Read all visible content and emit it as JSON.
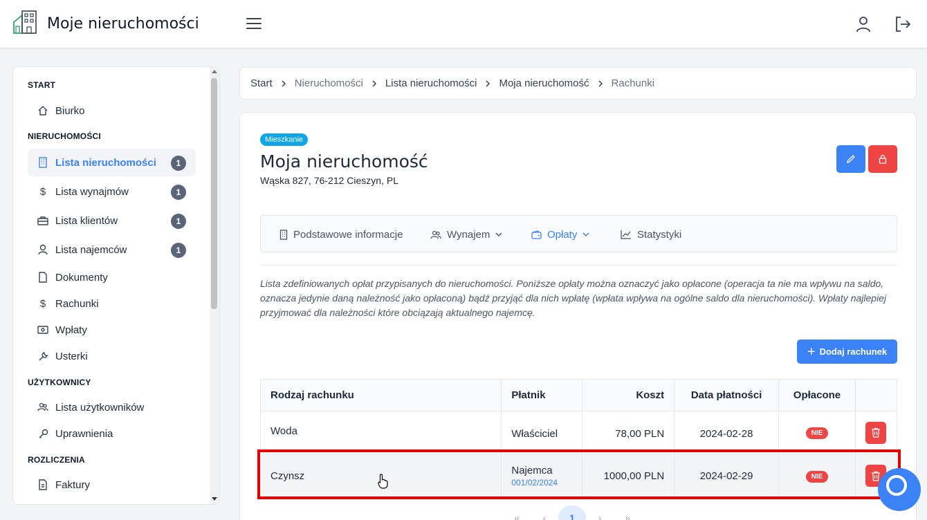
{
  "header": {
    "title": "Moje nieruchomości"
  },
  "sidebar": {
    "sections": {
      "start": "START",
      "nieruchomosci": "NIERUCHOMOŚCI",
      "uzytkownicy": "UŻYTKOWNICY",
      "rozliczenia": "ROZLICZENIA"
    },
    "items": [
      {
        "label": "Biurko",
        "icon": "home-icon"
      },
      {
        "label": "Lista nieruchomości",
        "icon": "building-icon",
        "badge": "1",
        "active": true
      },
      {
        "label": "Lista wynajmów",
        "icon": "dollar-icon",
        "badge": "1"
      },
      {
        "label": "Lista klientów",
        "icon": "briefcase-icon",
        "badge": "1"
      },
      {
        "label": "Lista najemców",
        "icon": "user-icon",
        "badge": "1"
      },
      {
        "label": "Dokumenty",
        "icon": "file-icon"
      },
      {
        "label": "Rachunki",
        "icon": "dollar-icon"
      },
      {
        "label": "Wpłaty",
        "icon": "cash-icon"
      },
      {
        "label": "Usterki",
        "icon": "wrench-icon"
      },
      {
        "label": "Lista użytkowników",
        "icon": "users-icon"
      },
      {
        "label": "Uprawnienia",
        "icon": "key-icon"
      },
      {
        "label": "Faktury",
        "icon": "invoice-icon"
      }
    ]
  },
  "breadcrumb": [
    "Start",
    "Nieruchomości",
    "Lista nieruchomości",
    "Moja nieruchomość",
    "Rachunki"
  ],
  "property": {
    "type_badge": "Mieszkanie",
    "name": "Moja nieruchomość",
    "address": "Wąska 827, 76-212 Cieszyn, PL"
  },
  "tabs": [
    {
      "label": "Podstawowe informacje",
      "icon": "building-icon"
    },
    {
      "label": "Wynajem",
      "icon": "users-icon",
      "dropdown": true
    },
    {
      "label": "Opłaty",
      "icon": "wallet-icon",
      "dropdown": true,
      "active": true
    },
    {
      "label": "Statystyki",
      "icon": "chart-icon"
    }
  ],
  "description": "Lista zdefiniowanych opłat przypisanych do nieruchomości. Poniższe opłaty można oznaczyć jako opłacone (operacja ta nie ma wpływu na saldo, oznacza jedynie daną należność jako opłaconą) bądź przyjąć dla nich wpłatę (wpłata wpływa na ogólne saldo dla nieruchomości). Wpłaty najlepiej przyjmować dla należności które obciązają aktualnego najemcę.",
  "add_button": "Dodaj rachunek",
  "table": {
    "headers": [
      "Rodzaj rachunku",
      "Płatnik",
      "Koszt",
      "Data płatności",
      "Opłacone"
    ],
    "rows": [
      {
        "type": "Woda",
        "payer": "Właściciel",
        "payer_sub": "",
        "cost": "78,00 PLN",
        "date": "2024-02-28",
        "paid": "NIE"
      },
      {
        "type": "Czynsz",
        "payer": "Najemca",
        "payer_sub": "001/02/2024",
        "cost": "1000,00 PLN",
        "date": "2024-02-29",
        "paid": "NIE"
      }
    ]
  },
  "pagination": {
    "first": "«",
    "prev": "‹",
    "current": "1",
    "next": "›",
    "last": "»"
  },
  "colors": {
    "primary": "#3b82f6",
    "danger": "#ef4444",
    "badge": "#0ea5e9",
    "highlight": "#e50000"
  }
}
